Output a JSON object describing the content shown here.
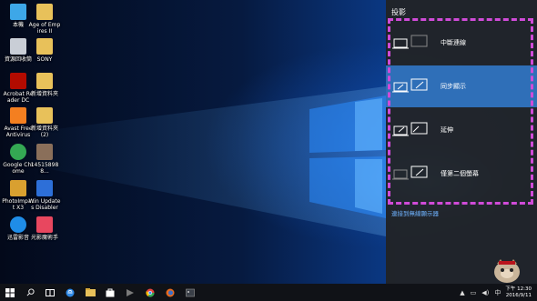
{
  "desktop": {
    "icons": [
      {
        "label": "本機",
        "icon": "computer-icon",
        "color": "#3da7e8"
      },
      {
        "label": "Age of Empires II",
        "icon": "folder-icon",
        "color": "#e8c15a"
      },
      {
        "label": "資源回收筒",
        "icon": "recycle-bin-icon",
        "color": "#c9ced6"
      },
      {
        "label": "SONY",
        "icon": "folder-icon",
        "color": "#e8c15a"
      },
      {
        "label": "Acrobat Reader DC",
        "icon": "acrobat-icon",
        "color": "#b30b00"
      },
      {
        "label": "新增資料夾",
        "icon": "folder-icon",
        "color": "#e8c15a"
      },
      {
        "label": "Avast Free Antivirus",
        "icon": "avast-icon",
        "color": "#f47f20"
      },
      {
        "label": "新增資料夾 (2)",
        "icon": "folder-icon",
        "color": "#e8c15a"
      },
      {
        "label": "Google Chrome",
        "icon": "chrome-icon",
        "color": "#34a853"
      },
      {
        "label": "145158988...",
        "icon": "photo-icon",
        "color": "#8a6f5a"
      },
      {
        "label": "PhotoImpact X3",
        "icon": "photoimpact-icon",
        "color": "#d9a030"
      },
      {
        "label": "Win Updates Disabler",
        "icon": "shield-icon",
        "color": "#2d6fd8"
      },
      {
        "label": "迅雷影音",
        "icon": "thunder-player-icon",
        "color": "#1f8de8"
      },
      {
        "label": "光影魔術手",
        "icon": "photo-editor-icon",
        "color": "#e8475f"
      }
    ]
  },
  "panel": {
    "title": "投影",
    "options": [
      {
        "label": "中斷連線",
        "icon": "pc-screen-only-icon",
        "selected": false
      },
      {
        "label": "同步顯示",
        "icon": "duplicate-icon",
        "selected": true
      },
      {
        "label": "延伸",
        "icon": "extend-icon",
        "selected": false
      },
      {
        "label": "僅第二個螢幕",
        "icon": "second-screen-only-icon",
        "selected": false
      }
    ],
    "wireless_link": "連接到無線顯示器"
  },
  "taskbar": {
    "buttons": [
      "start-icon",
      "search-icon",
      "task-view-icon",
      "edge-icon",
      "file-explorer-icon",
      "store-icon",
      "media-icon",
      "chrome-icon",
      "firefox-icon",
      "photo-icon"
    ],
    "clock_time": "下午 12:30",
    "clock_date": "2016/9/11"
  },
  "colors": {
    "highlight": "#2f6fb8",
    "annotation": "#d04bd8",
    "link": "#6fb3ff"
  }
}
